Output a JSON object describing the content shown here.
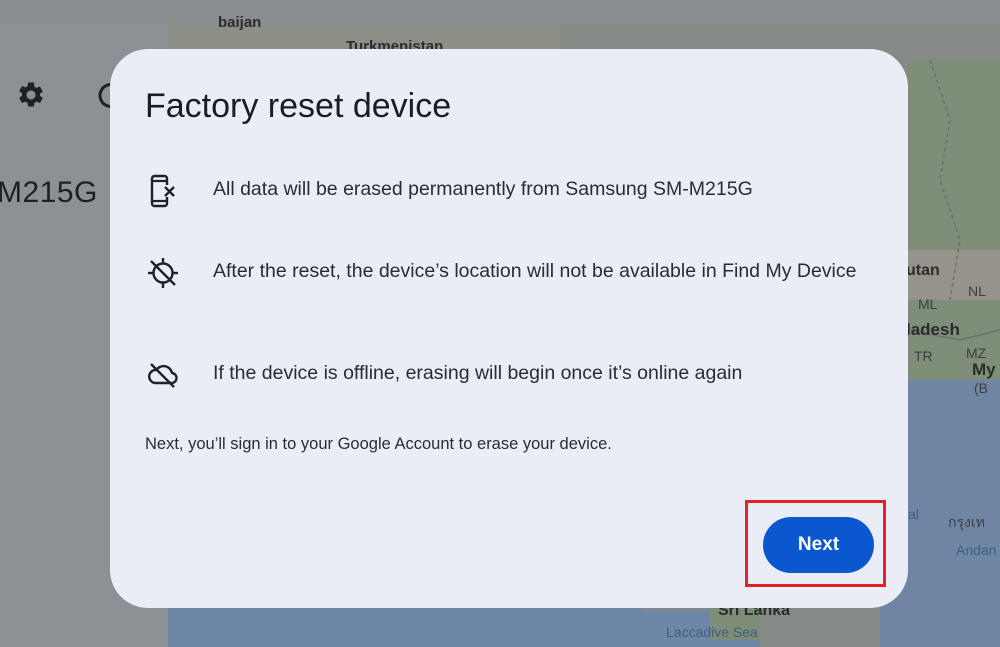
{
  "map": {
    "labels": [
      "Turkmenistan",
      "utan",
      "ladesh",
      "My",
      "Sri Lanka",
      "Laccadive Sea",
      "Andan",
      "กรุงเท",
      "ML",
      "NL",
      "MZ",
      "TR",
      "(B",
      "al",
      "baijan"
    ]
  },
  "panel": {
    "device_name": "M215G",
    "settings_icon": "gear-icon",
    "partial_icon": "partial-circle-icon"
  },
  "dialog": {
    "title": "Factory reset device",
    "items": [
      {
        "icon": "phone-erase-icon",
        "text": "All data will be erased permanently from Samsung SM-M215G"
      },
      {
        "icon": "location-off-icon",
        "text": "After the reset, the device’s location will not be available in Find My Device"
      },
      {
        "icon": "cloud-off-icon",
        "text": "If the device is offline, erasing will begin once it’s online again"
      }
    ],
    "footnote": "Next, you’ll sign in to your Google Account to erase your device.",
    "next_label": "Next"
  },
  "colors": {
    "primary_button": "#0b57d0",
    "dialog_background": "#eaedf5",
    "highlight": "#e4202a"
  }
}
